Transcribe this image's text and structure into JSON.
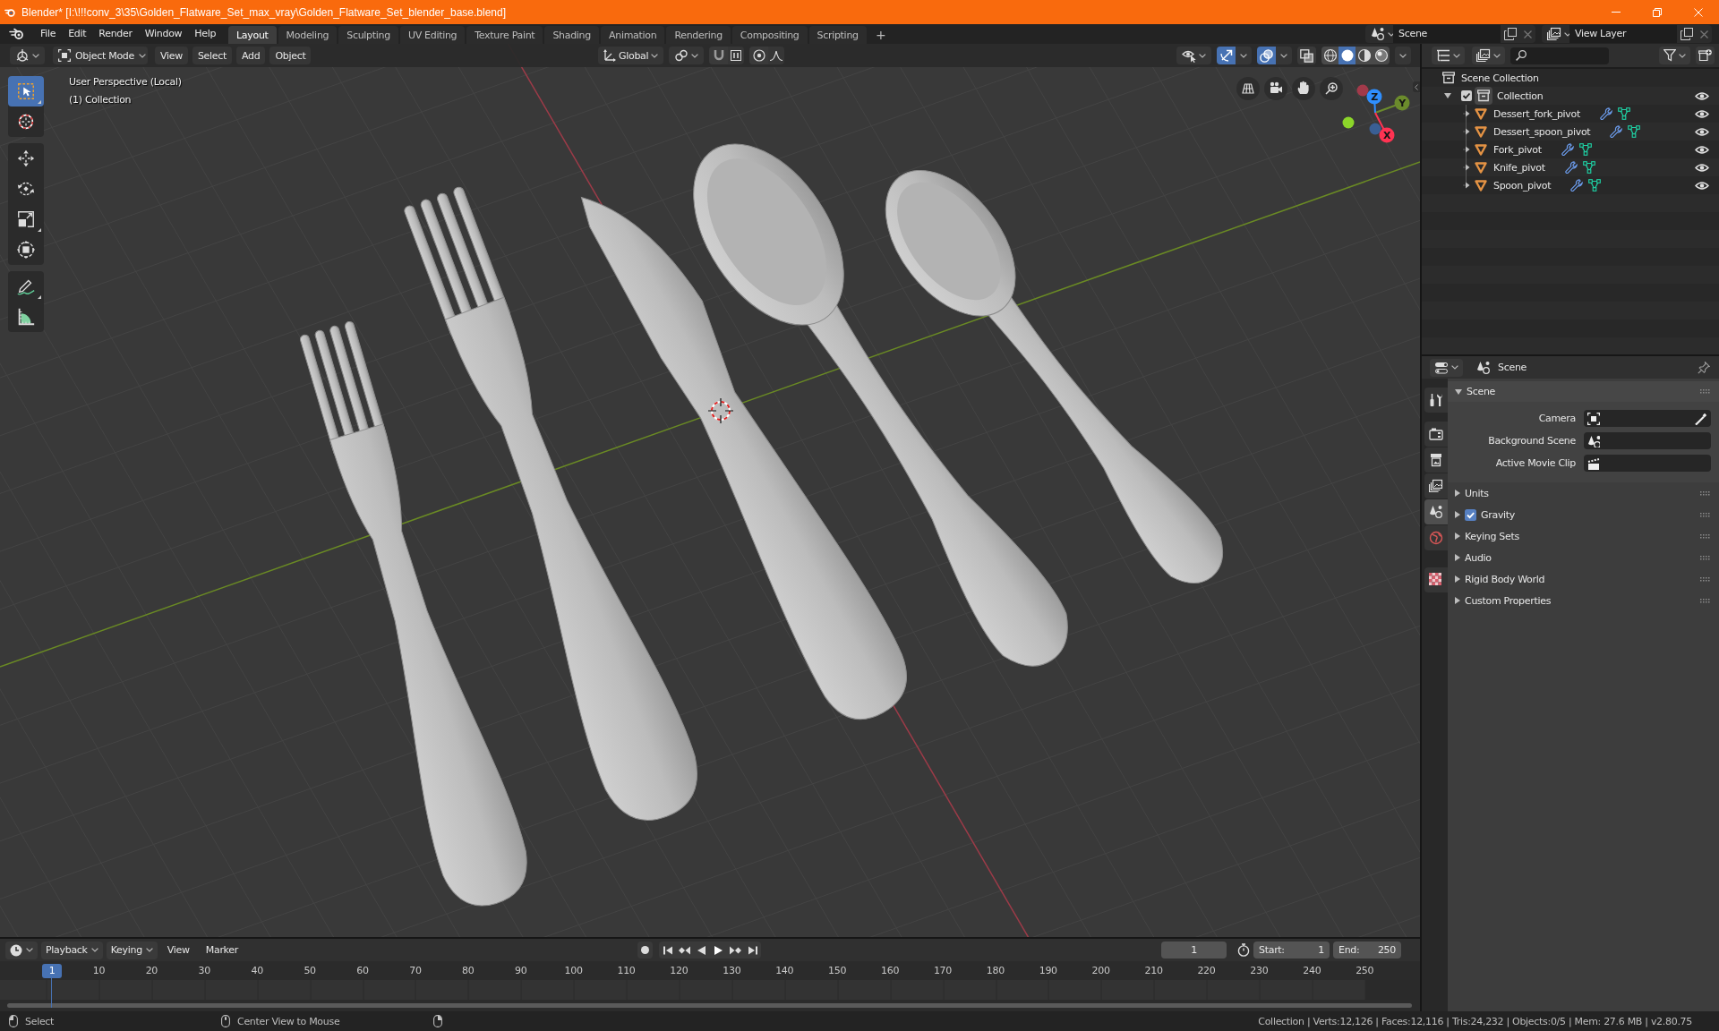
{
  "window": {
    "title": "Blender* [I:\\!!!conv_3\\35\\Golden_Flatware_Set_max_vray\\Golden_Flatware_Set_blender_base.blend]"
  },
  "menu": [
    "File",
    "Edit",
    "Render",
    "Window",
    "Help"
  ],
  "workspaces": [
    {
      "label": "Layout",
      "selected": true
    },
    {
      "label": "Modeling",
      "selected": false
    },
    {
      "label": "Sculpting",
      "selected": false
    },
    {
      "label": "UV Editing",
      "selected": false
    },
    {
      "label": "Texture Paint",
      "selected": false
    },
    {
      "label": "Shading",
      "selected": false
    },
    {
      "label": "Animation",
      "selected": false
    },
    {
      "label": "Rendering",
      "selected": false
    },
    {
      "label": "Compositing",
      "selected": false
    },
    {
      "label": "Scripting",
      "selected": false
    }
  ],
  "add_workspace": "+",
  "scene": {
    "value": "Scene"
  },
  "view_layer": {
    "value": "View Layer"
  },
  "viewport": {
    "mode": "Object Mode",
    "menus": [
      "View",
      "Select",
      "Add",
      "Object"
    ],
    "orientation": "Global",
    "snap": {
      "on": false
    },
    "proportional": {
      "on": false
    },
    "gizmos": {
      "on": true
    },
    "overlays": {
      "on": true
    },
    "xray": {
      "on": false
    },
    "shading": [
      {
        "kind": "wireframe",
        "selected": false
      },
      {
        "kind": "solid",
        "selected": true
      },
      {
        "kind": "material",
        "selected": false
      },
      {
        "kind": "rendered",
        "selected": false
      }
    ],
    "tools": [
      {
        "kind": "select_box",
        "selected": true
      },
      {
        "kind": "cursor",
        "selected": false
      },
      {
        "kind": "move",
        "selected": false
      },
      {
        "kind": "rotate",
        "selected": false
      },
      {
        "kind": "scale",
        "selected": false
      },
      {
        "kind": "transform",
        "selected": false
      },
      {
        "kind": "annotate",
        "selected": false
      },
      {
        "kind": "measure",
        "selected": false
      }
    ],
    "info": [
      "User Perspective (Local)",
      "(1) Collection"
    ],
    "gizmo": [
      {
        "label": "Z",
        "color": "#2f8fff"
      },
      {
        "label": "Y",
        "color": "#6b8b2c"
      },
      {
        "label": "X",
        "color": "#ff3352"
      },
      {
        "color": "#8cd62a"
      },
      {
        "color": "#a23a4a"
      },
      {
        "color": "#3a5f94"
      }
    ]
  },
  "outliner": {
    "root": "Scene Collection",
    "collections": [
      {
        "label": "Collection",
        "checked": true,
        "expanded": true,
        "visible": true,
        "children": [
          {
            "label": "Dessert_fork_pivot",
            "expanded": false,
            "visible": true
          },
          {
            "label": "Dessert_spoon_pivot",
            "expanded": false,
            "visible": true
          },
          {
            "label": "Fork_pivot",
            "expanded": false,
            "visible": true
          },
          {
            "label": "Knife_pivot",
            "expanded": false,
            "visible": true
          },
          {
            "label": "Spoon_pivot",
            "expanded": false,
            "visible": true
          }
        ]
      }
    ]
  },
  "properties": {
    "tabs": [
      {
        "kind": "tool",
        "selected": false
      },
      {
        "kind": "render",
        "selected": false
      },
      {
        "kind": "output",
        "selected": false
      },
      {
        "kind": "view_layer",
        "selected": false
      },
      {
        "kind": "scene",
        "selected": true
      },
      {
        "kind": "world",
        "selected": false
      },
      {
        "kind": "texture",
        "selected": false
      }
    ],
    "context": "Scene",
    "panels": [
      {
        "title": "Scene",
        "expanded": true,
        "fields": [
          {
            "label": "Camera",
            "kind": "camera"
          },
          {
            "label": "Background Scene",
            "kind": "scene"
          },
          {
            "label": "Active Movie Clip",
            "kind": "clip"
          }
        ]
      },
      {
        "title": "Units",
        "expanded": false
      },
      {
        "title": "Gravity",
        "expanded": false,
        "checked": true
      },
      {
        "title": "Keying Sets",
        "expanded": false
      },
      {
        "title": "Audio",
        "expanded": false
      },
      {
        "title": "Rigid Body World",
        "expanded": false
      },
      {
        "title": "Custom Properties",
        "expanded": false
      }
    ]
  },
  "timeline": {
    "menus": [
      "Playback",
      "Keying",
      "View",
      "Marker"
    ],
    "playhead": "1",
    "current_frame": "1",
    "start_label": "Start:",
    "start": "1",
    "end_label": "End:",
    "end": "250",
    "ticks": [
      "10",
      "20",
      "30",
      "40",
      "50",
      "60",
      "70",
      "80",
      "90",
      "100",
      "110",
      "120",
      "130",
      "140",
      "150",
      "160",
      "170",
      "180",
      "190",
      "200",
      "210",
      "220",
      "230",
      "240",
      "250"
    ]
  },
  "status_bar": {
    "hints": [
      {
        "kind": "left",
        "label": "Select"
      },
      {
        "kind": "middle",
        "label": "Center View to Mouse"
      },
      {
        "kind": "right"
      }
    ],
    "stats": "Collection | Verts:12,126 | Faces:12,116 | Tris:24,232 | Objects:0/5 | Mem: 27.6 MB | v2.80.75"
  }
}
